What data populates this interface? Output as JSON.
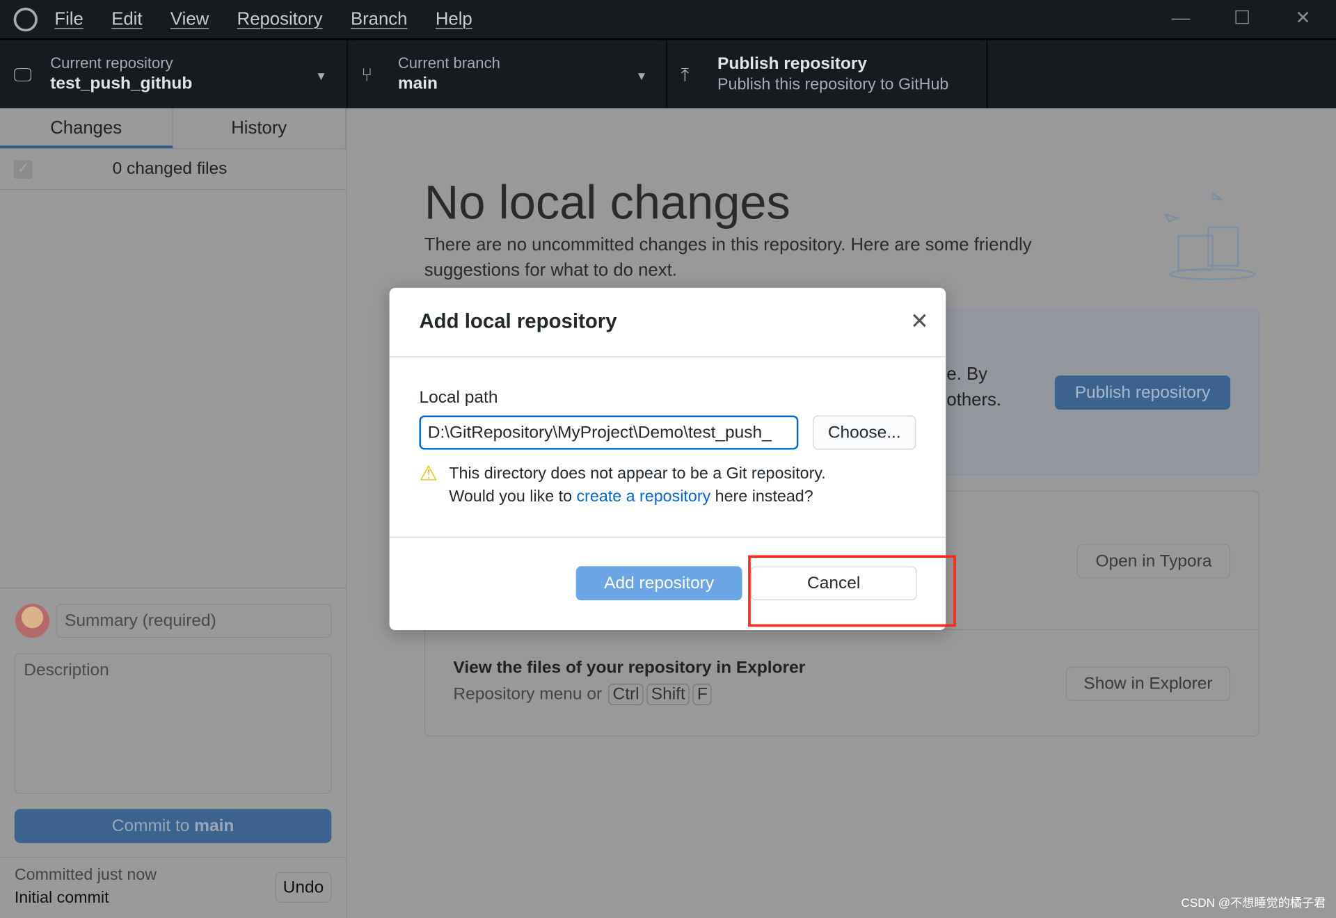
{
  "menu": {
    "items": [
      "File",
      "Edit",
      "View",
      "Repository",
      "Branch",
      "Help"
    ]
  },
  "toolbar": {
    "repo": {
      "label": "Current repository",
      "value": "test_push_github"
    },
    "branch": {
      "label": "Current branch",
      "value": "main"
    },
    "publish": {
      "title": "Publish repository",
      "subtitle": "Publish this repository to GitHub"
    }
  },
  "sidebar": {
    "tabs": [
      "Changes",
      "History"
    ],
    "changed_files": "0 changed files",
    "summary_placeholder": "Summary (required)",
    "description_placeholder": "Description",
    "commit_prefix": "Commit to ",
    "commit_branch": "main",
    "last_commit": {
      "time": "Committed just now",
      "message": "Initial commit",
      "undo": "Undo"
    }
  },
  "main": {
    "title": "No local changes",
    "description": "There are no uncommitted changes in this repository. Here are some friendly suggestions for what to do next.",
    "publish_card": {
      "text_partial_1": "e. By",
      "text_partial_2": "others.",
      "button": "Publish repository"
    },
    "open_card": {
      "button": "Open in Typora"
    },
    "explorer_card": {
      "title": "View the files of your repository in Explorer",
      "prefix": "Repository menu or",
      "keys": [
        "Ctrl",
        "Shift",
        "F"
      ],
      "button": "Show in Explorer"
    }
  },
  "dialog": {
    "title": "Add local repository",
    "path_label": "Local path",
    "path_value": "D:\\GitRepository\\MyProject\\Demo\\test_push_",
    "choose": "Choose...",
    "warning_line1": "This directory does not appear to be a Git repository.",
    "warning_pre": "Would you like to ",
    "warning_link": "create a repository",
    "warning_post": " here instead?",
    "add_button": "Add repository",
    "cancel_button": "Cancel"
  },
  "watermark": "CSDN @不想睡觉的橘子君",
  "colors": {
    "accent": "#0366d6",
    "highlight": "#ff2a1f",
    "warning": "#f0c000"
  }
}
